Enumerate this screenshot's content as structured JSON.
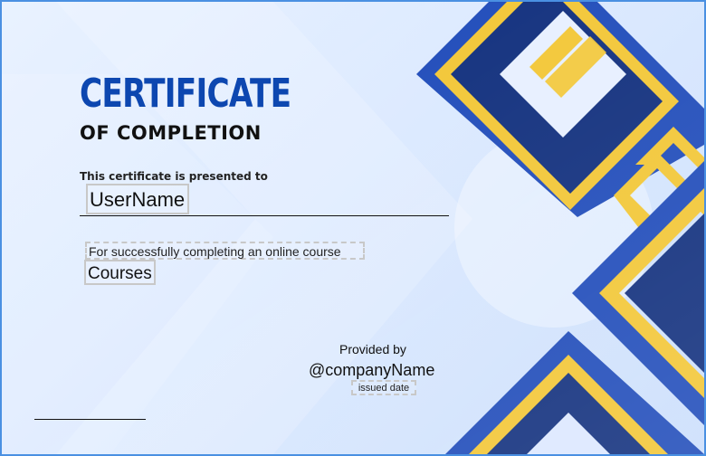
{
  "certificate": {
    "title": "CERTIFICATE",
    "subtitle": "OF COMPLETION",
    "presented_to": "This certificate is presented to",
    "username": "UserName",
    "course_description": "For successfully completing an online course",
    "courses": "Courses",
    "provided_by": "Provided by",
    "company_name": "@companyName",
    "issued_date": "issued date"
  },
  "colors": {
    "frame_border": "#4a90e2",
    "title_blue": "#0d47b0",
    "navy": "#0b2a7a",
    "royal_blue": "#1a47b8",
    "gold": "#f2c531"
  }
}
